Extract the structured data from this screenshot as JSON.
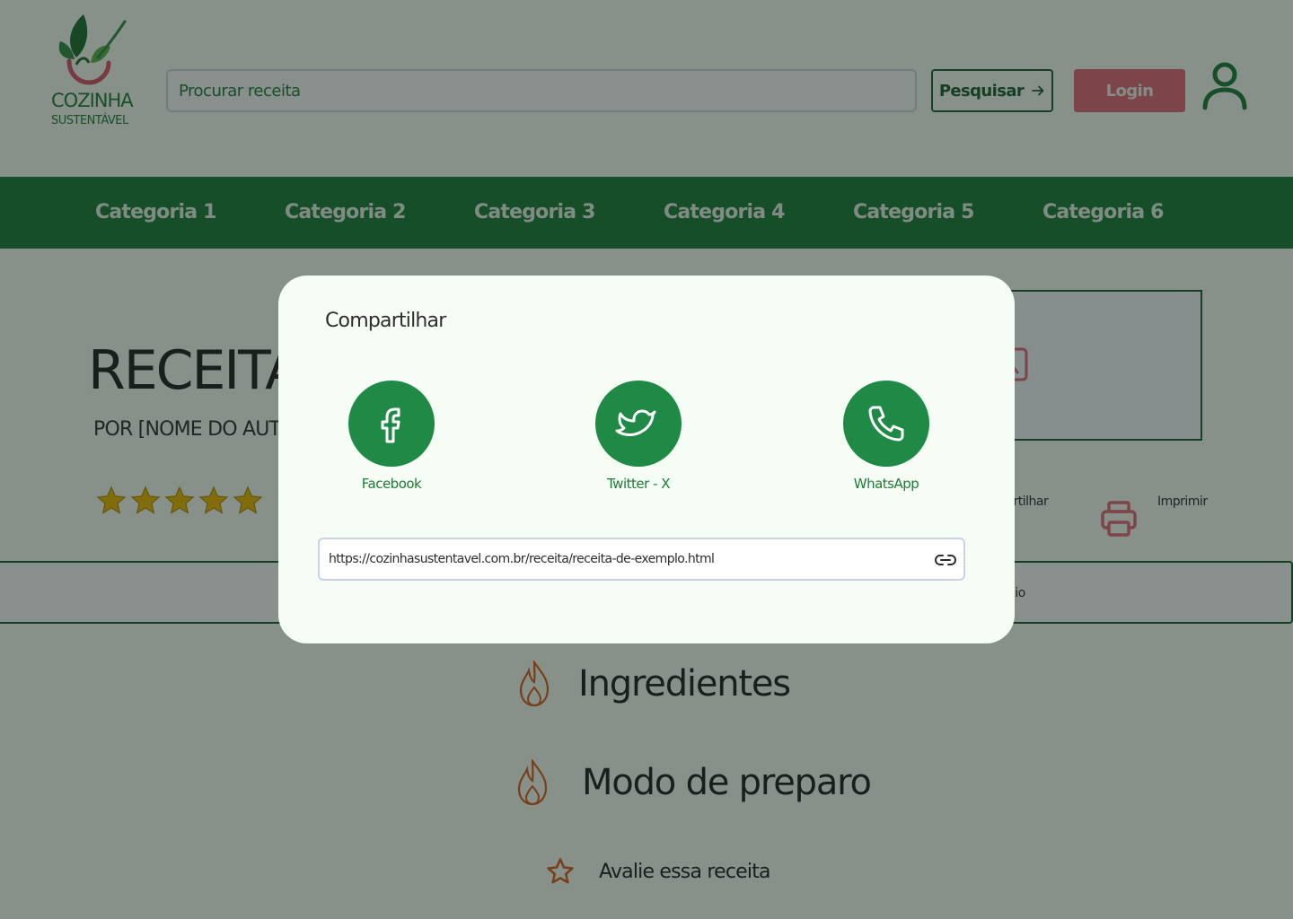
{
  "brand": {
    "name_line1": "COZINHA",
    "name_line2": "SUSTENTÁVEL"
  },
  "header": {
    "search_placeholder": "Procurar receita",
    "search_button_label": "Pesquisar",
    "login_label": "Login"
  },
  "nav": {
    "categories": [
      "Categoria 1",
      "Categoria 2",
      "Categoria 3",
      "Categoria 4",
      "Categoria 5",
      "Categoria 6"
    ]
  },
  "recipe": {
    "title": "RECEITA D",
    "author": "POR [NOME DO AUTOR]",
    "rating": 5,
    "rating_max": 5,
    "share_label": "partilhar",
    "print_label": "Imprimir",
    "info_bar_text": "dio"
  },
  "sections": {
    "ingredients": "Ingredientes",
    "method": "Modo de preparo",
    "rate": "Avalie essa receita"
  },
  "share_modal": {
    "title": "Compartilhar",
    "options": [
      {
        "label": "Facebook",
        "icon": "facebook-icon"
      },
      {
        "label": "Twitter - X",
        "icon": "twitter-icon"
      },
      {
        "label": "WhatsApp",
        "icon": "phone-icon"
      }
    ],
    "link": "https://cozinhasustentavel.com.br/receita/receita-de-exemplo.html"
  },
  "colors": {
    "primary_green": "#1A7A38",
    "share_circle_green": "#1F8A45",
    "login_pink": "#E0677A",
    "star_gold": "#E8B400",
    "accent_orange": "#D55E1E",
    "overlay": "rgba(17, 32, 22, 0.48)"
  }
}
